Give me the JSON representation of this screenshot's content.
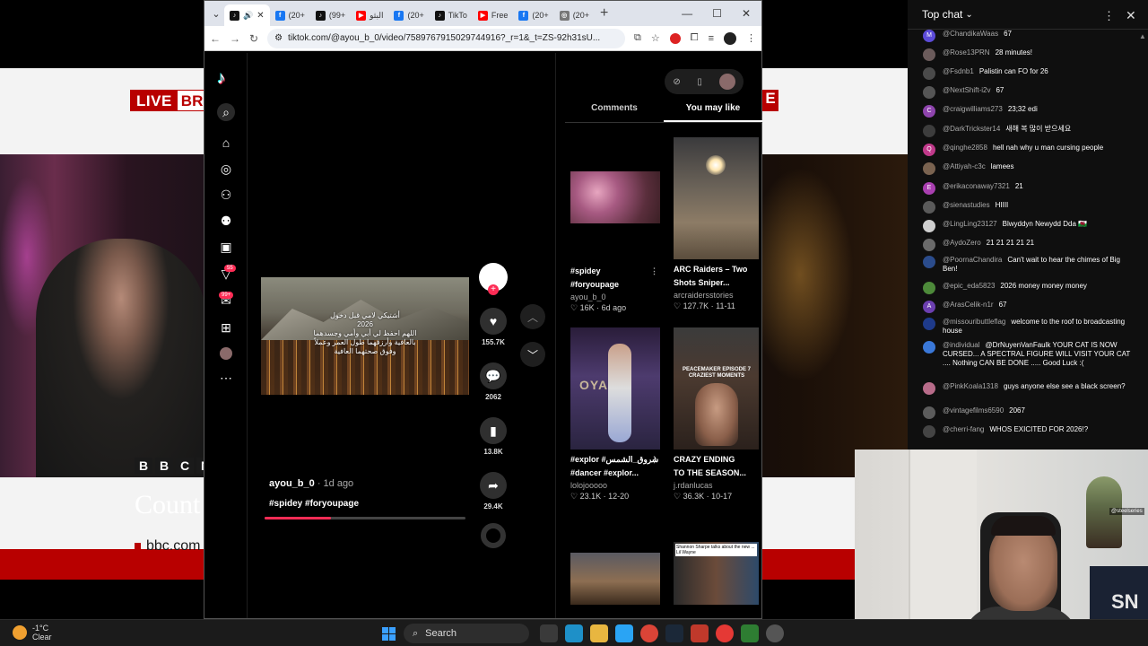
{
  "broadcast": {
    "live_label": "LIVE",
    "live_partial": "BRO",
    "live_partial_right": "E",
    "bbc_logo": [
      "B",
      "B",
      "C",
      "N"
    ],
    "headline_partial": "Count",
    "url_partial": "bbc.com"
  },
  "browser": {
    "tabs": [
      {
        "label": "",
        "icon": "tiktok-icon",
        "active": true
      },
      {
        "label": "(20+",
        "icon": "facebook-icon"
      },
      {
        "label": "(99+",
        "icon": "tiktok-icon"
      },
      {
        "label": "البثو",
        "icon": "youtube-icon"
      },
      {
        "label": "(20+",
        "icon": "facebook-icon"
      },
      {
        "label": "TikTo",
        "icon": "tiktok-icon"
      },
      {
        "label": "Free",
        "icon": "youtube-icon"
      },
      {
        "label": "(20+",
        "icon": "facebook-icon"
      },
      {
        "label": "(20+",
        "icon": "web-icon"
      }
    ],
    "url": "tiktok.com/@ayou_b_0/video/7589767915029744916?_r=1&_t=ZS-92h31sU..."
  },
  "tiktok": {
    "video_caption_year": "2026",
    "video_caption_lines": [
      "أشتيكي لامي قبل دخول",
      "اللهم احفظ لي أبي وأمي وجسدهما",
      "بالعافية وأرزقهما طول العمر وعملاً",
      "وفوق صحتهما العافية"
    ],
    "likes": "155.7K",
    "comments": "2062",
    "saves": "13.8K",
    "shares": "29.4K",
    "author": "ayou_b_0",
    "post_time": "· 1d ago",
    "hashtags": "#spidey #foryoupage",
    "progress": 0.33,
    "nav_badge_inbox": "55",
    "nav_badge_messages": "99+",
    "side_tabs": {
      "comments": "Comments",
      "you_may_like": "You may like"
    },
    "recommendations": [
      {
        "title1": "#spidey",
        "title2": "#foryoupage",
        "author": "ayou_b_0",
        "likes": "16K",
        "date": "6d ago"
      },
      {
        "title1": "ARC Raiders – Two",
        "title2": "Shots Sniper...",
        "author": "arcraidersstories",
        "likes": "127.7K",
        "date": "11-11"
      },
      {
        "title1": "#explor #شروق_الشمس",
        "title2": "#dancer #explor...",
        "author": "lolojooooo",
        "likes": "23.1K",
        "date": "12-20"
      },
      {
        "title1": "CRAZY ENDING",
        "title2": "TO THE SEASON...",
        "author": "j.rdanlucas",
        "likes": "36.3K",
        "date": "10-17"
      }
    ],
    "rec4_overlay": "PEACEMAKER EPISODE 7 CRAZIEST MOMENTS",
    "rec5_overlay": "Shannon Sharpe talks about the new ... Lil Wayne",
    "rec2_overlay": "OYA"
  },
  "chat": {
    "title": "Top chat",
    "messages": [
      {
        "author": "@ChandikaWaas",
        "text": "67",
        "color": "#5c4bd8",
        "initial": "M"
      },
      {
        "author": "@Rose13PRN",
        "text": "28 minutes!",
        "color": "#6b5b5b",
        "initial": ""
      },
      {
        "author": "@Fsdnb1",
        "text": "Palistin can FO for 26",
        "color": "#4a4a4a",
        "initial": ""
      },
      {
        "author": "@NextShift-i2v",
        "text": "67",
        "color": "#555555",
        "initial": ""
      },
      {
        "author": "@craigwilliams273",
        "text": "23;32 edi",
        "color": "#8e44ad",
        "initial": "C"
      },
      {
        "author": "@DarkTrickster14",
        "text": "새해 복 많이 받으세요",
        "color": "#3d3d3d",
        "initial": ""
      },
      {
        "author": "@qinghe2858",
        "text": "hell nah why u man cursing people",
        "color": "#c0398a",
        "initial": "Q"
      },
      {
        "author": "@Attiyah-c3c",
        "text": "lamees",
        "color": "#7a6350",
        "initial": ""
      },
      {
        "author": "@erikaconaway7321",
        "text": "21",
        "color": "#a93fb0",
        "initial": "E"
      },
      {
        "author": "@sienastudies",
        "text": "HIIII",
        "color": "#5a5a5a",
        "initial": ""
      },
      {
        "author": "@LingLing23127",
        "text": "Blwyddyn Newydd Dda 🏴󠁧󠁢󠁷󠁬󠁳󠁿",
        "color": "#cfcfcf",
        "initial": ""
      },
      {
        "author": "@AydoZero",
        "text": "21 21 21 21 21",
        "color": "#6a6a6a",
        "initial": ""
      },
      {
        "author": "@PoornaChandira",
        "text": "Can't wait to hear the chimes of Big Ben!",
        "color": "#2b4c8c",
        "initial": ""
      },
      {
        "author": "@epic_eda5823",
        "text": "2026 money money money",
        "color": "#4d8a3a",
        "initial": ""
      },
      {
        "author": "@ArasCelik-n1r",
        "text": "67",
        "color": "#6c3fb0",
        "initial": "A"
      },
      {
        "author": "@missouributtleflag",
        "text": "welcome to the roof to broadcasting house",
        "color": "#1e3a8a",
        "initial": ""
      },
      {
        "author": "@individual",
        "text": "@DrNuyenVanFaulk YOUR CAT IS NOW CURSED... A SPECTRAL FIGURE WILL VISIT YOUR CAT .... Nothing CAN BE DONE ..... Good Luck :(",
        "color": "#3a78d8",
        "initial": ""
      },
      {
        "author": "@PinkKoala1318",
        "text": "guys anyone else see a black screen?",
        "color": "#b86c8a",
        "initial": ""
      },
      {
        "author": "@vintagefilms6590",
        "text": "2067",
        "color": "#5c5c5c",
        "initial": ""
      },
      {
        "author": "@cherri-fang",
        "text": "WHOS EXICITED FOR 2026!?",
        "color": "#444444",
        "initial": ""
      }
    ]
  },
  "webcam": {
    "banner": "@steelseries",
    "wall_text": "SN"
  },
  "taskbar": {
    "temperature": "-1°C",
    "weather": "Clear",
    "search_label": "Search"
  }
}
